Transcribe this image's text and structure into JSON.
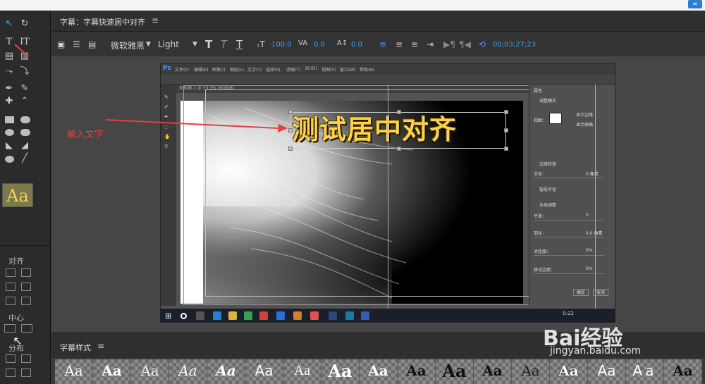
{
  "title_panel": {
    "title": "字幕：字幕快速居中对齐",
    "menu_icon": "≡"
  },
  "toolbar": {
    "font_family": "微软雅黑",
    "font_style": "Light",
    "font_size": "100.0",
    "kerning": "0.0",
    "baseline": "0.0",
    "timecode": "00;03;27;23"
  },
  "left_panel": {
    "align_label": "对齐",
    "center_label": "中心",
    "distribute_label": "分布",
    "swatch_text": "Aa"
  },
  "photoshop": {
    "menu": [
      "文件(F)",
      "编辑(E)",
      "图像(I)",
      "图层(L)",
      "文字(Y)",
      "选择(S)",
      "滤镜(T)",
      "3D(D)",
      "视图(V)",
      "窗口(W)",
      "帮助(H)"
    ],
    "props_title": "属性",
    "props_mode": "调整模式",
    "view_label": "视图：",
    "show_edge": "显示边缘",
    "show_orig": "显示原稿",
    "edge_detect": "边缘检测",
    "radius": "半径：",
    "radius_val": "0 像素",
    "smart_radius": "智能半径",
    "global_adjust": "全局调整",
    "smooth": "平滑：",
    "smooth_val": "0",
    "feather": "羽化：",
    "feather_val": "0.0 像素",
    "contrast": "对比度：",
    "contrast_val": "0%",
    "shift_edge": "移动边缘：",
    "shift_val": "0%",
    "ok": "确定",
    "cancel": "取消",
    "zoom": "100%",
    "time": "0:22"
  },
  "caption": "测试居中对齐",
  "annotation": "输入文字",
  "styles_panel": {
    "title": "字幕样式",
    "menu_icon": "≡"
  },
  "style_samples": [
    "Aa",
    "Aa",
    "Aa",
    "Aa",
    "Aa",
    "Aa",
    "Aa",
    "Aa",
    "Aa",
    "Aa",
    "Aa",
    "Aa",
    "Aa",
    "Aa",
    "Aa",
    "Aa",
    "Aa"
  ],
  "watermark": {
    "brand": "Bai经验",
    "url": "jingyan.baidu.com"
  },
  "colors": {
    "accent": "#4a9eff",
    "caption": "#ffd24a",
    "annotation": "#e34040"
  }
}
